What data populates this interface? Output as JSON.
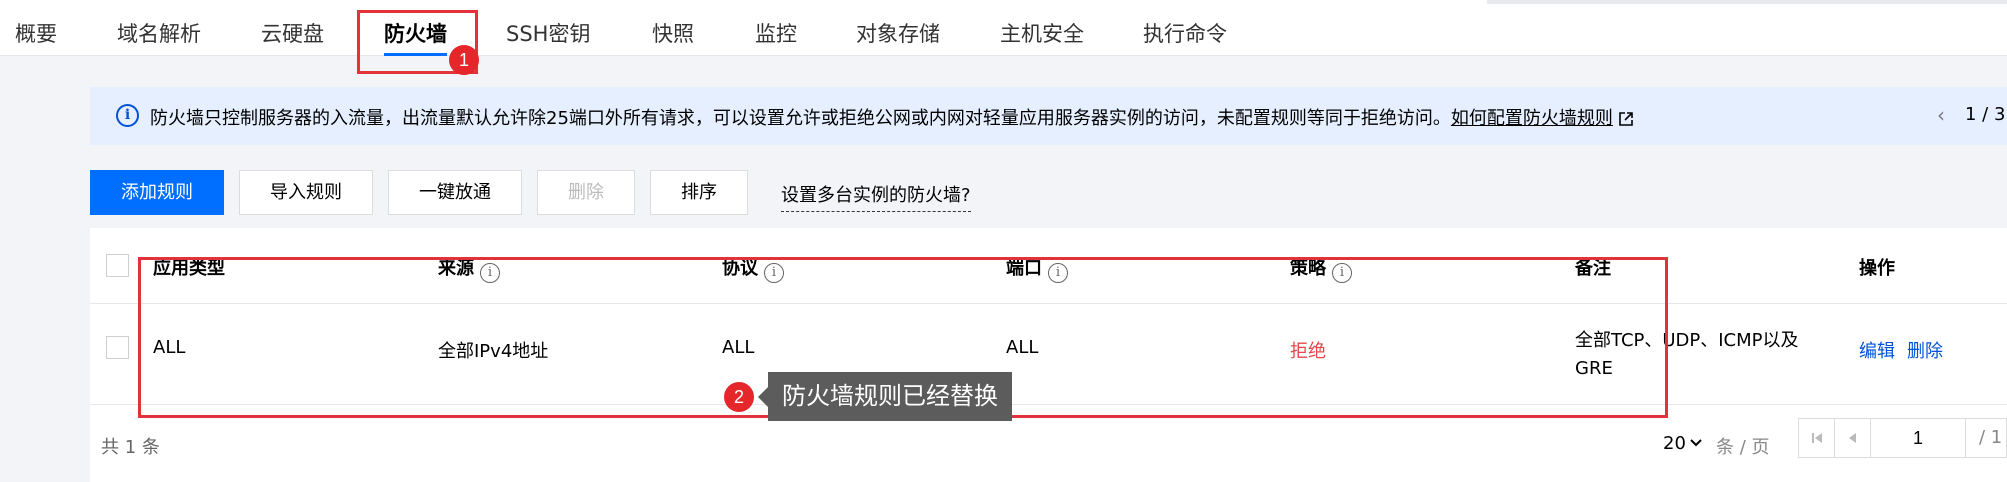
{
  "tabs": [
    {
      "label": "概要"
    },
    {
      "label": "域名解析"
    },
    {
      "label": "云硬盘"
    },
    {
      "label": "防火墙"
    },
    {
      "label": "SSH密钥"
    },
    {
      "label": "快照"
    },
    {
      "label": "监控"
    },
    {
      "label": "对象存储"
    },
    {
      "label": "主机安全"
    },
    {
      "label": "执行命令"
    }
  ],
  "notice": {
    "icon": "info-icon",
    "text": "防火墙只控制服务器的入流量，出流量默认允许除25端口外所有请求，可以设置允许或拒绝公网或内网对轻量应用服务器实例的访问，未配置规则等同于拒绝访问。",
    "link": "如何配置防火墙规则",
    "pager": "1 / 3"
  },
  "toolbar": {
    "add": "添加规则",
    "import": "导入规则",
    "allow_all": "一键放通",
    "delete": "删除",
    "sort": "排序",
    "multi_instance_link": "设置多台实例的防火墙?"
  },
  "table": {
    "headers": {
      "app_type": "应用类型",
      "source": "来源",
      "protocol": "协议",
      "port": "端口",
      "policy": "策略",
      "remark": "备注",
      "action": "操作"
    },
    "rows": [
      {
        "app_type": "ALL",
        "source": "全部IPv4地址",
        "protocol": "ALL",
        "port": "ALL",
        "policy": "拒绝",
        "remark": "全部TCP、UDP、ICMP以及GRE",
        "edit": "编辑",
        "delete": "删除"
      }
    ]
  },
  "footer": {
    "total": "共 1 条",
    "page_size": "20",
    "per_page": "条 / 页",
    "current_page": "1",
    "total_pages": "/ 1"
  },
  "annotations": {
    "badge1": "1",
    "badge2": "2",
    "tooltip": "防火墙规则已经替换"
  },
  "colors": {
    "accent": "#006eff",
    "danger": "#e54545",
    "annotation": "#e2333a"
  }
}
